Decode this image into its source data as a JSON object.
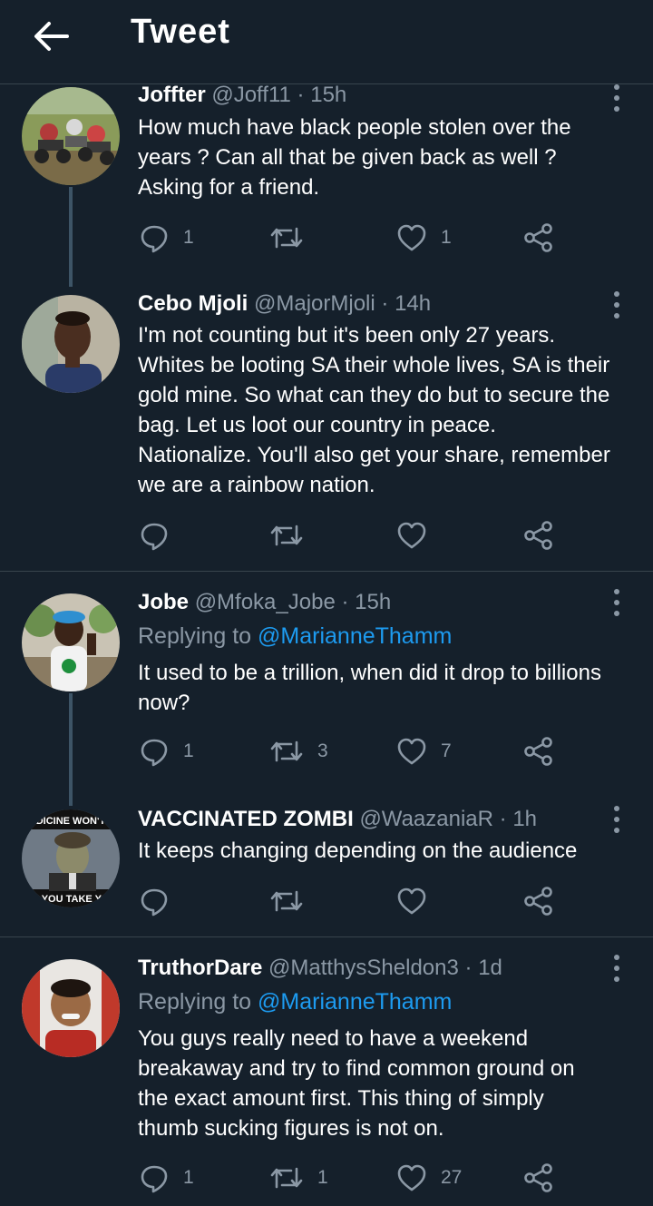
{
  "header": {
    "title": "Tweet"
  },
  "tweets": [
    {
      "name": "Joffter",
      "handle": "@Joff11",
      "time": "15h",
      "lines": [
        "How much have black people stolen over the",
        "years ? Can all that be given back as well ?",
        "Asking for a friend."
      ],
      "counts": {
        "reply": "1",
        "retweet": "",
        "like": "1"
      }
    },
    {
      "name": "Cebo Mjoli",
      "handle": "@MajorMjoli",
      "time": "14h",
      "lines": [
        "I'm not counting but it's been only 27 years.",
        "Whites be looting SA their whole lives, SA is their",
        "gold mine. So what can they do but to secure the",
        "bag. Let us loot our country in peace.",
        "Nationalize. You'll also get your share, remember",
        "we are a rainbow nation."
      ],
      "counts": {
        "reply": "",
        "retweet": "",
        "like": ""
      }
    },
    {
      "name": "Jobe",
      "handle": "@Mfoka_Jobe",
      "time": "15h",
      "replying_prefix": "Replying to",
      "replying_to": "@MarianneThamm",
      "lines": [
        "It used to be a trillion, when did it drop to billions",
        "now?"
      ],
      "counts": {
        "reply": "1",
        "retweet": "3",
        "like": "7"
      }
    },
    {
      "name": "VACCINATED ZOMBI",
      "handle": "@WaazaniaR",
      "time": "1h",
      "avatar_text_top": "DICINE WON'T",
      "avatar_text_bottom": "S YOU TAKE YO",
      "lines": [
        "It keeps changing depending on the audience"
      ],
      "counts": {
        "reply": "",
        "retweet": "",
        "like": ""
      }
    },
    {
      "name": "TruthorDare",
      "handle": "@MatthysSheldon3",
      "time": "1d",
      "replying_prefix": "Replying to",
      "replying_to": "@MarianneThamm",
      "lines": [
        "You guys really need to have a weekend",
        "breakaway and  try to find common ground on",
        "the exact amount first. This thing of simply",
        "thumb sucking figures is not on."
      ],
      "counts": {
        "reply": "1",
        "retweet": "1",
        "like": "27"
      }
    }
  ],
  "separator": "·",
  "colors": {
    "background": "#15202b",
    "accent": "#1d9bf0",
    "muted": "#8b98a5",
    "border": "#38444d"
  }
}
